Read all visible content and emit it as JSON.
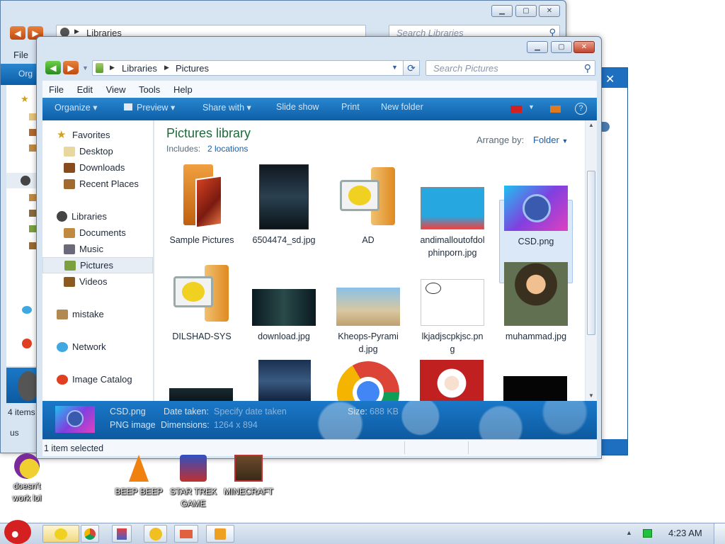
{
  "back_window": {
    "address_path": "Libraries",
    "search_placeholder": "Search Libraries",
    "menu_file": "File",
    "organize_fragment": "Org",
    "status_items": "4 items",
    "status_fragment": "us"
  },
  "window": {
    "address_path": [
      "Libraries",
      "Pictures"
    ],
    "search_placeholder": "Search Pictures",
    "menu": [
      "File",
      "Edit",
      "View",
      "Tools",
      "Help"
    ],
    "toolbar": [
      "Organize",
      "Preview",
      "Share with",
      "Slide show",
      "Print",
      "New folder"
    ],
    "nav": {
      "favorites": "Favorites",
      "desktop": "Desktop",
      "downloads": "Downloads",
      "recent": "Recent Places",
      "libraries": "Libraries",
      "documents": "Documents",
      "music": "Music",
      "pictures": "Pictures",
      "videos": "Videos",
      "mistake": "mistake",
      "network": "Network",
      "image_catalog": "Image Catalog"
    },
    "library_title": "Pictures library",
    "includes_label": "Includes:",
    "includes_link": "2 locations",
    "arrange_label": "Arrange by:",
    "arrange_value": "Folder",
    "files": [
      "Sample Pictures",
      "6504474_sd.jpg",
      "AD",
      "andimalloutofdolphinporn.jpg",
      "CSD.png",
      "DILSHAD-SYS",
      "download.jpg",
      "Kheops-Pyramid.jpg",
      "lkjadjscpkjsc.png",
      "muhammad.jpg"
    ],
    "details": {
      "name": "CSD.png",
      "type": "PNG image",
      "date_label": "Date taken:",
      "date_value": "Specify date taken",
      "dims_label": "Dimensions:",
      "dims_value": "1264 x 894",
      "size_label": "Size:",
      "size_value": "688 KB"
    },
    "status": "1 item selected"
  },
  "desktop_icons": {
    "yahoo": "doesn't work lol",
    "beep": "BEEP BEEP",
    "startrek": "STAR TREK GAME",
    "minecraft": "MINECRAFT"
  },
  "taskbar": {
    "clock": "4:23 AM"
  }
}
